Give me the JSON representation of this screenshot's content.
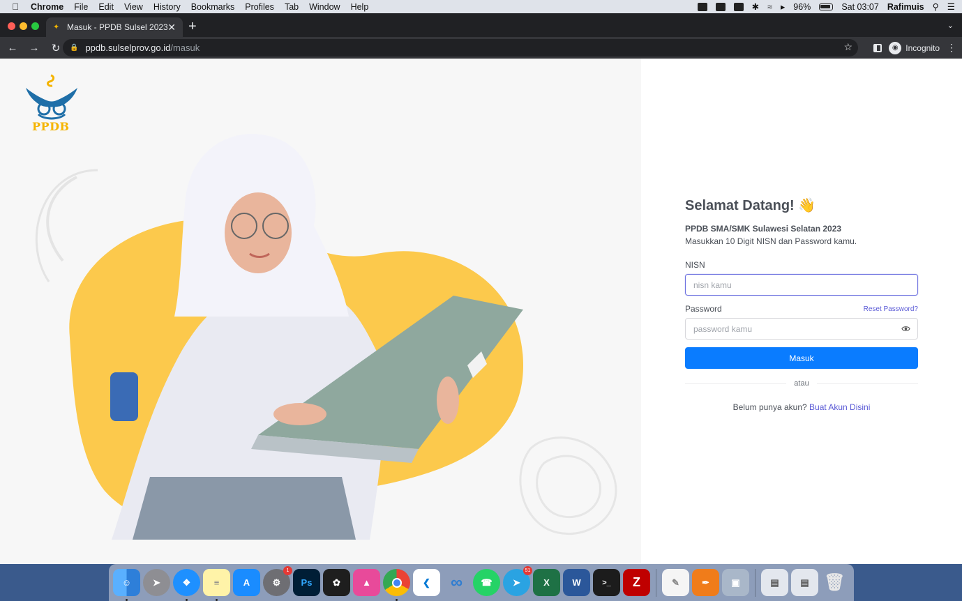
{
  "menubar": {
    "app_name": "Chrome",
    "items": [
      "File",
      "Edit",
      "View",
      "History",
      "Bookmarks",
      "Profiles",
      "Tab",
      "Window",
      "Help"
    ],
    "battery": "96%",
    "clock": "Sat 03:07",
    "user": "Rafimuis"
  },
  "browser": {
    "tab_title": "Masuk - PPDB Sulsel 2023",
    "url_host": "ppdb.sulselprov.go.id",
    "url_path": "/masuk",
    "profile_label": "Incognito"
  },
  "brand": {
    "logo_text": "PPDB",
    "logo_color": "#f5b400",
    "accent_blue": "#1f6fa8"
  },
  "login": {
    "welcome": "Selamat Datang! 👋",
    "subtitle": "PPDB SMA/SMK Sulawesi Selatan 2023",
    "instruction": "Masukkan 10 Digit NISN dan Password kamu.",
    "nisn_label": "NISN",
    "nisn_placeholder": "nisn kamu",
    "nisn_value": "",
    "password_label": "Password",
    "reset_link": "Reset Password?",
    "password_placeholder": "password kamu",
    "password_value": "",
    "submit_label": "Masuk",
    "divider_text": "atau",
    "signup_prompt": "Belum punya akun?",
    "signup_link": "Buat Akun Disini",
    "primary_color": "#0a7cff",
    "link_color": "#5b5bd6"
  },
  "dock": {
    "telegram_badge": "51",
    "settings_badge": "1"
  }
}
